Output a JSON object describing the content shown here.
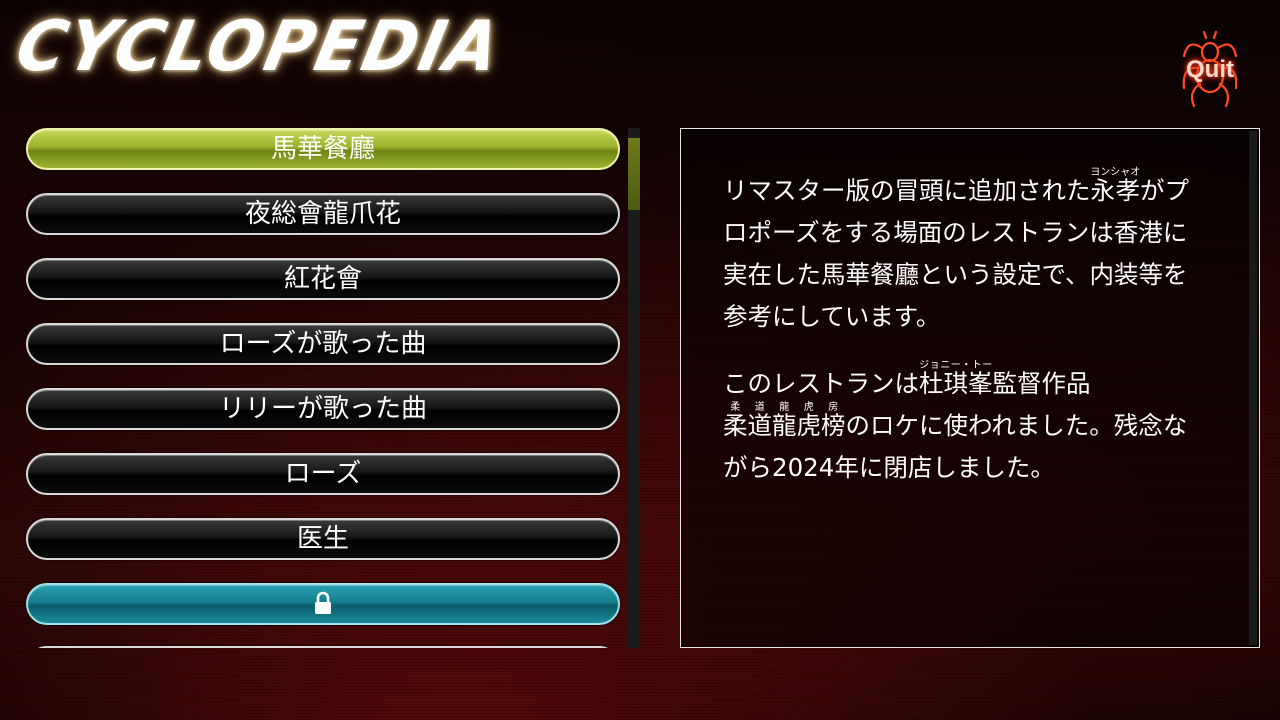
{
  "header": {
    "title": "CYCLOPEDIA",
    "quit_label": "Quit"
  },
  "menu": {
    "items": [
      {
        "label": "馬華餐廳",
        "state": "selected"
      },
      {
        "label": "夜総會龍爪花",
        "state": "normal"
      },
      {
        "label": "紅花會",
        "state": "normal"
      },
      {
        "label": "ローズが歌った曲",
        "state": "normal"
      },
      {
        "label": "リリーが歌った曲",
        "state": "normal"
      },
      {
        "label": "ローズ",
        "state": "normal"
      },
      {
        "label": "医生",
        "state": "normal"
      },
      {
        "label": "",
        "state": "locked",
        "icon": "lock-icon"
      }
    ]
  },
  "description": {
    "p1": {
      "a": "リマスター版の冒頭に追加された",
      "ruby1_base": "永孝",
      "ruby1_reading": "ヨンシャオ",
      "b": "がプロポーズをする場面のレストランは香港に実在した馬華餐廳という設定で、内装等を参考にしています。"
    },
    "p2": {
      "a": "このレストランは",
      "ruby1_base": "杜琪峯",
      "ruby1_reading": "ジョニー・トー",
      "b": "監督作品",
      "ruby2_base": "柔道龍虎榜",
      "ruby2_reading": "柔道龍虎房",
      "c": "のロケに使われました。残念ながら2024年に閉店しました。"
    }
  },
  "colors": {
    "selected_item": "#9cb02a",
    "locked_item": "#147c8c",
    "quit_glow": "#ff3a1a"
  }
}
